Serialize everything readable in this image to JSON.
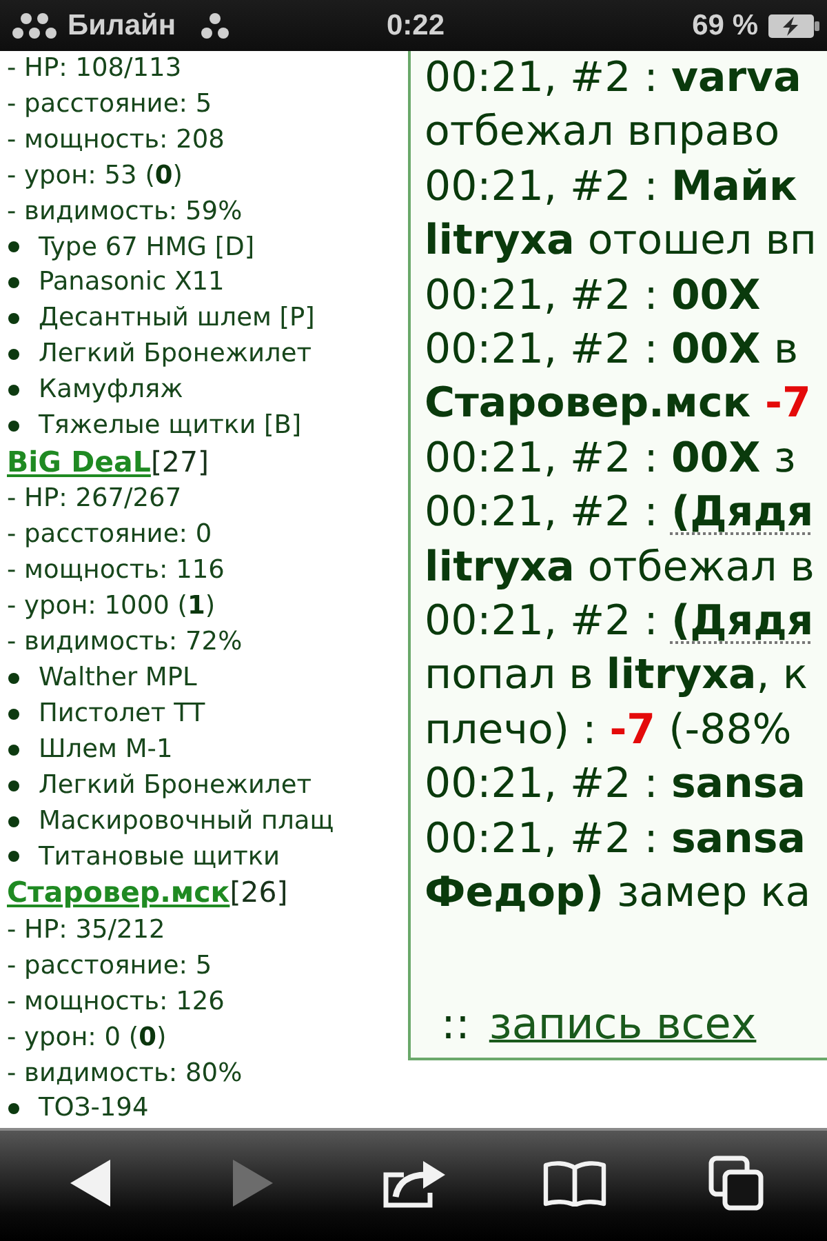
{
  "status_bar": {
    "carrier": "Билайн",
    "time": "0:22",
    "battery": "69 %",
    "charging": true
  },
  "players": [
    {
      "stats": [
        "- HP: 108/113",
        "- расстояние: 5",
        "- мощность: 208",
        "- урон: 53 (**0**)",
        "- видимость: 59%"
      ],
      "items": [
        "Type 67 HMG [D]",
        "Panasonic X11",
        "Десантный шлем [P]",
        "Легкий Бронежилет",
        "Камуфляж",
        "Тяжелые щитки [B]"
      ]
    },
    {
      "name": "BiG DeaL",
      "level": "[27]",
      "stats": [
        "- HP: 267/267",
        "- расстояние: 0",
        "- мощность: 116",
        "- урон: 1000 (**1**)",
        "- видимость: 72%"
      ],
      "items": [
        "Walther MPL",
        "Пистолет ТТ",
        "Шлем М-1",
        "Легкий Бронежилет",
        "Маскировочный плащ",
        "Титановые щитки"
      ]
    },
    {
      "name": "Старовер.мск",
      "level": "[26]",
      "stats": [
        "- HP: 35/212",
        "- расстояние: 5",
        "- мощность: 126",
        "- урон: 0 (**0**)",
        "- видимость: 80%"
      ],
      "items": [
        "ТОЗ-194"
      ]
    }
  ],
  "log": {
    "lines": [
      [
        {
          "kind": "plain",
          "text": "00:21, #2 : "
        },
        {
          "kind": "bold",
          "text": "varva"
        }
      ],
      [
        {
          "kind": "plain",
          "text": "отбежал вправо"
        }
      ],
      [
        {
          "kind": "plain",
          "text": "00:21, #2 : "
        },
        {
          "kind": "bold",
          "text": "Майк"
        }
      ],
      [
        {
          "kind": "bold",
          "text": "litryxa"
        },
        {
          "kind": "plain",
          "text": " отошел вп"
        }
      ],
      [
        {
          "kind": "plain",
          "text": "00:21, #2 : "
        },
        {
          "kind": "bold",
          "text": "00X"
        }
      ],
      [
        {
          "kind": "plain",
          "text": "00:21, #2 : "
        },
        {
          "kind": "bold",
          "text": "00X"
        },
        {
          "kind": "plain",
          "text": " в"
        }
      ],
      [
        {
          "kind": "bold",
          "text": "Старовер.мск "
        },
        {
          "kind": "penalty",
          "text": "-7"
        }
      ],
      [
        {
          "kind": "plain",
          "text": "00:21, #2 : "
        },
        {
          "kind": "bold",
          "text": "00X"
        },
        {
          "kind": "plain",
          "text": " з"
        }
      ],
      [
        {
          "kind": "plain",
          "text": "00:21, #2 : "
        },
        {
          "kind": "dotted",
          "text": "(Дядя"
        }
      ],
      [
        {
          "kind": "bold",
          "text": "litryxa"
        },
        {
          "kind": "plain",
          "text": " отбежал в"
        }
      ],
      [
        {
          "kind": "plain",
          "text": "00:21, #2 : "
        },
        {
          "kind": "dotted",
          "text": "(Дядя"
        }
      ],
      [
        {
          "kind": "plain",
          "text": "попал в "
        },
        {
          "kind": "bold",
          "text": "litryxa"
        },
        {
          "kind": "plain",
          "text": ", к"
        }
      ],
      [
        {
          "kind": "plain",
          "text": "плечо) : "
        },
        {
          "kind": "penalty",
          "text": "-7"
        },
        {
          "kind": "plain",
          "text": " (-88%"
        }
      ],
      [
        {
          "kind": "plain",
          "text": "00:21, #2 : "
        },
        {
          "kind": "bold",
          "text": "sansa"
        }
      ],
      [
        {
          "kind": "plain",
          "text": "00:21, #2 : "
        },
        {
          "kind": "bold",
          "text": "sansa"
        }
      ],
      [
        {
          "kind": "bold",
          "text": "Федор)"
        },
        {
          "kind": "plain",
          "text": " замер ка"
        }
      ]
    ],
    "footer": {
      "prefix": "::",
      "link": "запись всех"
    }
  },
  "toolbar": [
    {
      "kind": "back",
      "disabled": false
    },
    {
      "kind": "forward",
      "disabled": true
    },
    {
      "kind": "share",
      "disabled": false
    },
    {
      "kind": "bookmarks",
      "disabled": false
    },
    {
      "kind": "tabs",
      "disabled": false
    }
  ]
}
